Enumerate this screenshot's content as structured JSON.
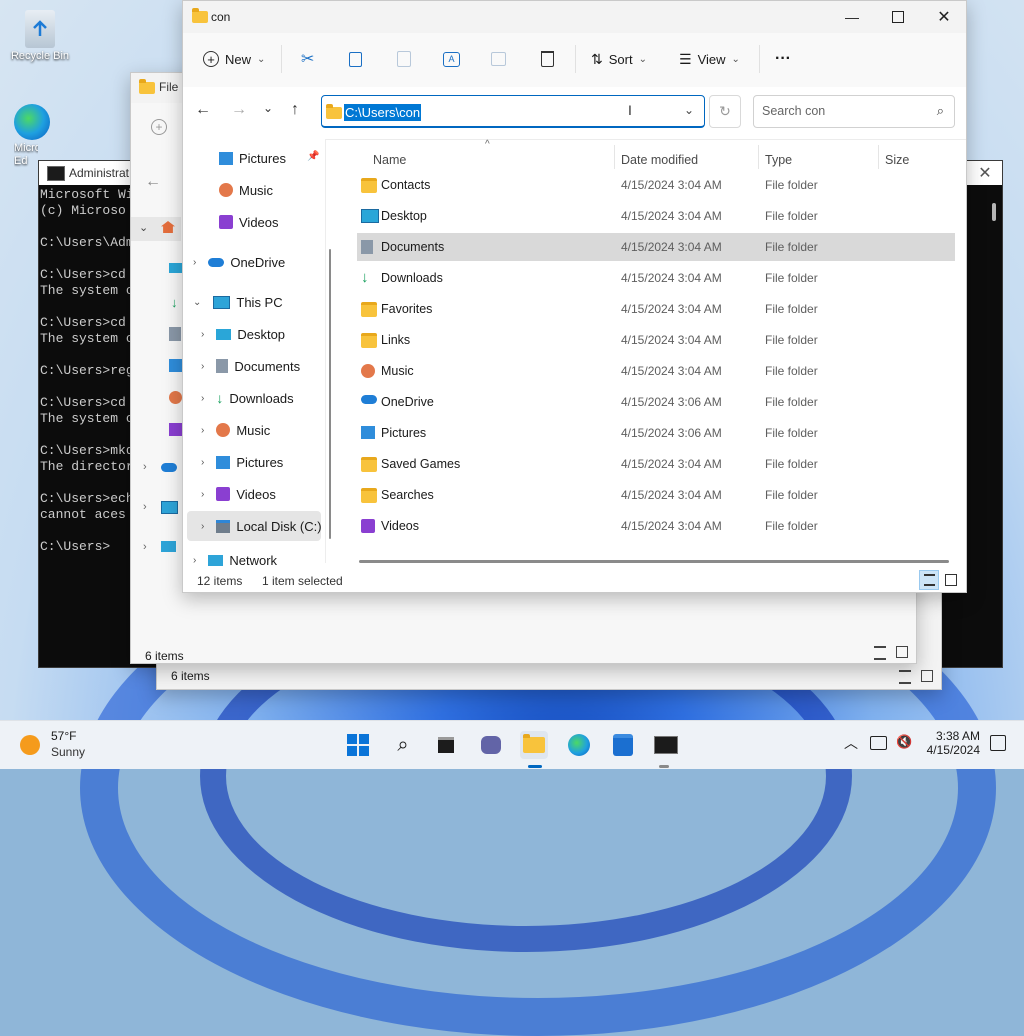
{
  "desktop": {
    "icons": [
      {
        "label": "Recycle Bin"
      },
      {
        "label": "Micro\nEd"
      }
    ]
  },
  "cmd": {
    "title": "Administrat",
    "lines": [
      "Microsoft Wi",
      "(c) Microso",
      "",
      "C:\\Users\\Adm",
      "",
      "C:\\Users>cd",
      "The system c",
      "",
      "C:\\Users>cd",
      "The system c",
      "",
      "C:\\Users>reg",
      "",
      "C:\\Users>cd",
      "The system c",
      "",
      "C:\\Users>mkd",
      "The director",
      "",
      "C:\\Users>ech",
      "cannot aces",
      "",
      "C:\\Users>"
    ]
  },
  "back_explorer_1": {
    "title": "File",
    "status": "6 items"
  },
  "back_explorer_2": {
    "status": "6 items"
  },
  "explorer": {
    "title": "con",
    "toolbar": {
      "new_label": "New",
      "sort_label": "Sort",
      "view_label": "View",
      "more_label": "···"
    },
    "address": "C:\\Users\\con",
    "search_placeholder": "Search con",
    "nav_items": [
      {
        "label": "Pictures",
        "icon": "pictures-icon",
        "pinned": true
      },
      {
        "label": "Music",
        "icon": "music-icon"
      },
      {
        "label": "Videos",
        "icon": "videos-icon"
      },
      {
        "label": "OneDrive",
        "icon": "onedrive-icon",
        "expandable": true
      },
      {
        "label": "This PC",
        "icon": "pc-icon",
        "expanded": true
      },
      {
        "label": "Desktop",
        "icon": "desktop-icon"
      },
      {
        "label": "Documents",
        "icon": "documents-icon"
      },
      {
        "label": "Downloads",
        "icon": "downloads-icon"
      },
      {
        "label": "Music",
        "icon": "music-icon"
      },
      {
        "label": "Pictures",
        "icon": "pictures-icon"
      },
      {
        "label": "Videos",
        "icon": "videos-icon"
      },
      {
        "label": "Local Disk (C:)",
        "icon": "drive-icon",
        "selected": true
      },
      {
        "label": "Network",
        "icon": "network-icon"
      }
    ],
    "columns": {
      "name": "Name",
      "date": "Date modified",
      "type": "Type",
      "size": "Size"
    },
    "files": [
      {
        "name": "Contacts",
        "date": "4/15/2024 3:04 AM",
        "type": "File folder",
        "icon": "folder-icon"
      },
      {
        "name": "Desktop",
        "date": "4/15/2024 3:04 AM",
        "type": "File folder",
        "icon": "desktop-icon"
      },
      {
        "name": "Documents",
        "date": "4/15/2024 3:04 AM",
        "type": "File folder",
        "icon": "documents-icon",
        "selected": true
      },
      {
        "name": "Downloads",
        "date": "4/15/2024 3:04 AM",
        "type": "File folder",
        "icon": "downloads-icon"
      },
      {
        "name": "Favorites",
        "date": "4/15/2024 3:04 AM",
        "type": "File folder",
        "icon": "folder-icon"
      },
      {
        "name": "Links",
        "date": "4/15/2024 3:04 AM",
        "type": "File folder",
        "icon": "folder-icon"
      },
      {
        "name": "Music",
        "date": "4/15/2024 3:04 AM",
        "type": "File folder",
        "icon": "music-icon"
      },
      {
        "name": "OneDrive",
        "date": "4/15/2024 3:06 AM",
        "type": "File folder",
        "icon": "onedrive-icon"
      },
      {
        "name": "Pictures",
        "date": "4/15/2024 3:06 AM",
        "type": "File folder",
        "icon": "pictures-icon"
      },
      {
        "name": "Saved Games",
        "date": "4/15/2024 3:04 AM",
        "type": "File folder",
        "icon": "folder-icon"
      },
      {
        "name": "Searches",
        "date": "4/15/2024 3:04 AM",
        "type": "File folder",
        "icon": "folder-icon"
      },
      {
        "name": "Videos",
        "date": "4/15/2024 3:04 AM",
        "type": "File folder",
        "icon": "videos-icon"
      }
    ],
    "status": {
      "count": "12 items",
      "selection": "1 item selected"
    }
  },
  "taskbar": {
    "weather_temp": "57°F",
    "weather_desc": "Sunny",
    "time": "3:38 AM",
    "date": "4/15/2024"
  },
  "colors": {
    "accent": "#0078d4",
    "folder": "#f8c33c",
    "selected_row": "#d9d9d9"
  }
}
